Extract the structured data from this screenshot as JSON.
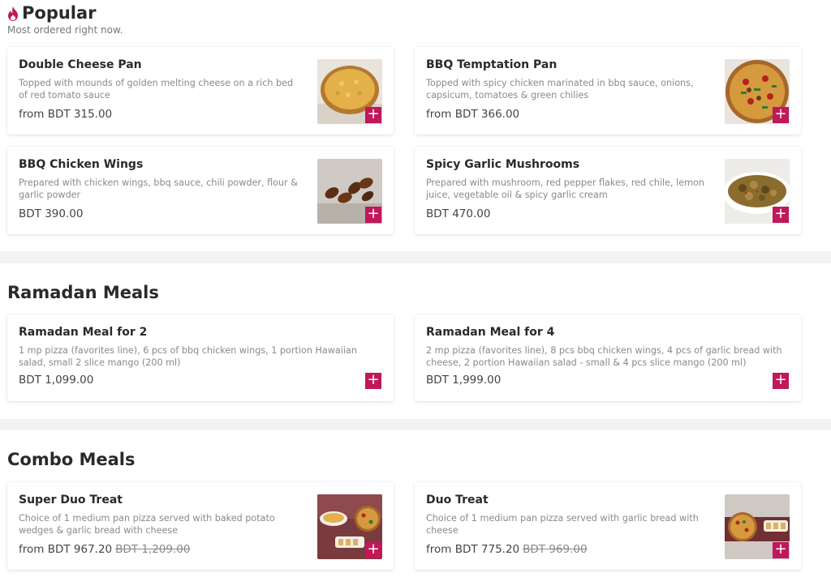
{
  "colors": {
    "accent": "#c0185a",
    "background": "#f3f3f3",
    "card": "#ffffff"
  },
  "sections": {
    "popular": {
      "title": "Popular",
      "icon": "flame-icon",
      "subtitle": "Most ordered right now.",
      "items": [
        {
          "name": "Double Cheese Pan",
          "description": "Topped with mounds of golden melting cheese on a rich bed of red tomato sauce",
          "price": "from BDT 315.00",
          "image": "cheese-pizza-image",
          "add_label": "+"
        },
        {
          "name": "BBQ Temptation Pan",
          "description": "Topped with spicy chicken marinated in bbq sauce, onions, capsicum, tomatoes & green chilies",
          "price": "from BDT 366.00",
          "image": "bbq-pizza-image",
          "add_label": "+"
        },
        {
          "name": "BBQ Chicken Wings",
          "description": "Prepared with chicken wings, bbq sauce, chili powder, flour & garlic powder",
          "price": "BDT 390.00",
          "image": "chicken-wings-image",
          "add_label": "+"
        },
        {
          "name": "Spicy Garlic Mushrooms",
          "description": "Prepared with mushroom, red pepper flakes, red chile, lemon juice, vegetable oil & spicy garlic cream",
          "price": "BDT 470.00",
          "image": "mushrooms-image",
          "add_label": "+"
        }
      ]
    },
    "ramadan": {
      "title": "Ramadan Meals",
      "items": [
        {
          "name": "Ramadan Meal for 2",
          "description": "1 mp pizza (favorites line), 6 pcs of bbq chicken wings, 1 portion Hawaiian salad, small 2 slice mango (200 ml)",
          "price": "BDT 1,099.00",
          "add_label": "+"
        },
        {
          "name": "Ramadan Meal for 4",
          "description": "2 mp pizza (favorites line), 8 pcs bbq chicken wings, 4 pcs of garlic bread with cheese, 2 portion Hawaiian salad - small & 4 pcs slice mango (200 ml)",
          "price": "BDT 1,999.00",
          "add_label": "+"
        }
      ]
    },
    "combo": {
      "title": "Combo Meals",
      "items": [
        {
          "name": "Super Duo Treat",
          "description": "Choice of 1 medium pan pizza served with baked potato wedges & garlic bread with cheese",
          "price": "from BDT 967.20",
          "old_price": "BDT 1,209.00",
          "image": "super-duo-image",
          "add_label": "+"
        },
        {
          "name": "Duo Treat",
          "description": "Choice of 1 medium pan pizza served with garlic bread with cheese",
          "price": "from BDT 775.20",
          "old_price": "BDT 969.00",
          "image": "duo-treat-image",
          "add_label": "+"
        }
      ]
    }
  }
}
